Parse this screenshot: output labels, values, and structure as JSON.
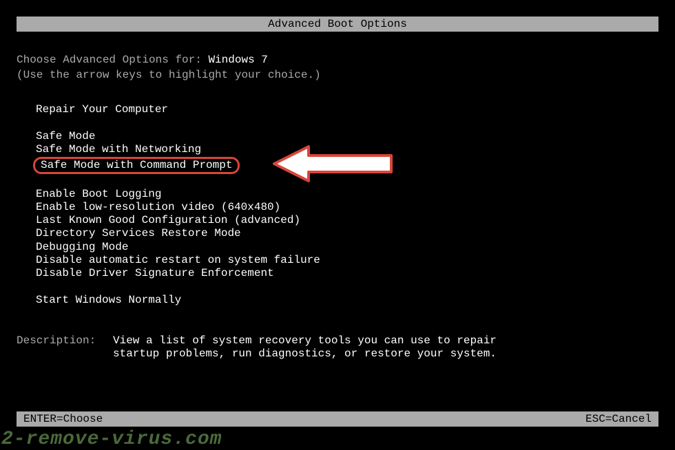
{
  "title": "Advanced Boot Options",
  "prompt": {
    "prefix": "Choose Advanced Options for: ",
    "os": "Windows 7"
  },
  "instruction": "(Use the arrow keys to highlight your choice.)",
  "groups": {
    "repair": "Repair Your Computer",
    "safe1": "Safe Mode",
    "safe2": "Safe Mode with Networking",
    "safe3": "Safe Mode with Command Prompt",
    "adv1": "Enable Boot Logging",
    "adv2": "Enable low-resolution video (640x480)",
    "adv3": "Last Known Good Configuration (advanced)",
    "adv4": "Directory Services Restore Mode",
    "adv5": "Debugging Mode",
    "adv6": "Disable automatic restart on system failure",
    "adv7": "Disable Driver Signature Enforcement",
    "normal": "Start Windows Normally"
  },
  "description": {
    "label": "Description:",
    "text": "View a list of system recovery tools you can use to repair startup problems, run diagnostics, or restore your system."
  },
  "footer": {
    "enter": "ENTER=Choose",
    "esc": "ESC=Cancel"
  },
  "watermark": "2-remove-virus.com",
  "colors": {
    "highlight_border": "#d9453a"
  }
}
